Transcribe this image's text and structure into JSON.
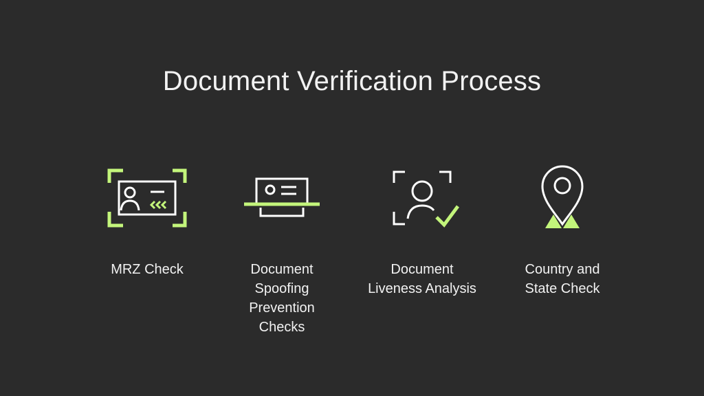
{
  "title": "Document Verification Process",
  "colors": {
    "background": "#2b2b2b",
    "accent": "#c3f57b",
    "icon_stroke": "#ffffff"
  },
  "steps": [
    {
      "label": "MRZ Check",
      "icon": "id-card-scan-icon"
    },
    {
      "label": "Document Spoofing Prevention Checks",
      "icon": "document-scanner-icon"
    },
    {
      "label": "Document Liveness Analysis",
      "icon": "face-verified-icon"
    },
    {
      "label": "Country and State Check",
      "icon": "map-pin-icon"
    }
  ]
}
